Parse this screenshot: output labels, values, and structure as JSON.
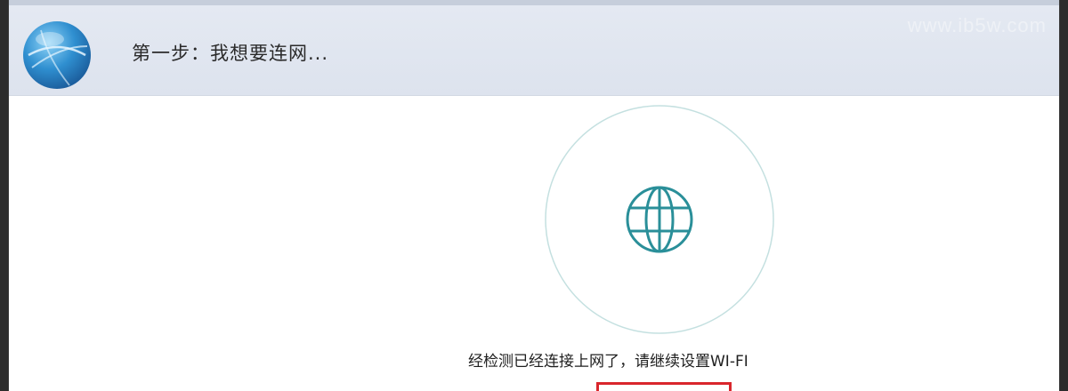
{
  "header": {
    "step_title": "第一步：我想要连网...",
    "watermark": "www.ib5w.com"
  },
  "icons": {
    "logo": "globe-logo-icon",
    "status": "globe-icon"
  },
  "status": {
    "message": "经检测已经连接上网了，请继续设置WI-FI"
  },
  "colors": {
    "header_bg": "#e4e9f2",
    "ring": "#b9dcdc",
    "globe": "#2a8f99",
    "highlight": "#d9262c"
  }
}
